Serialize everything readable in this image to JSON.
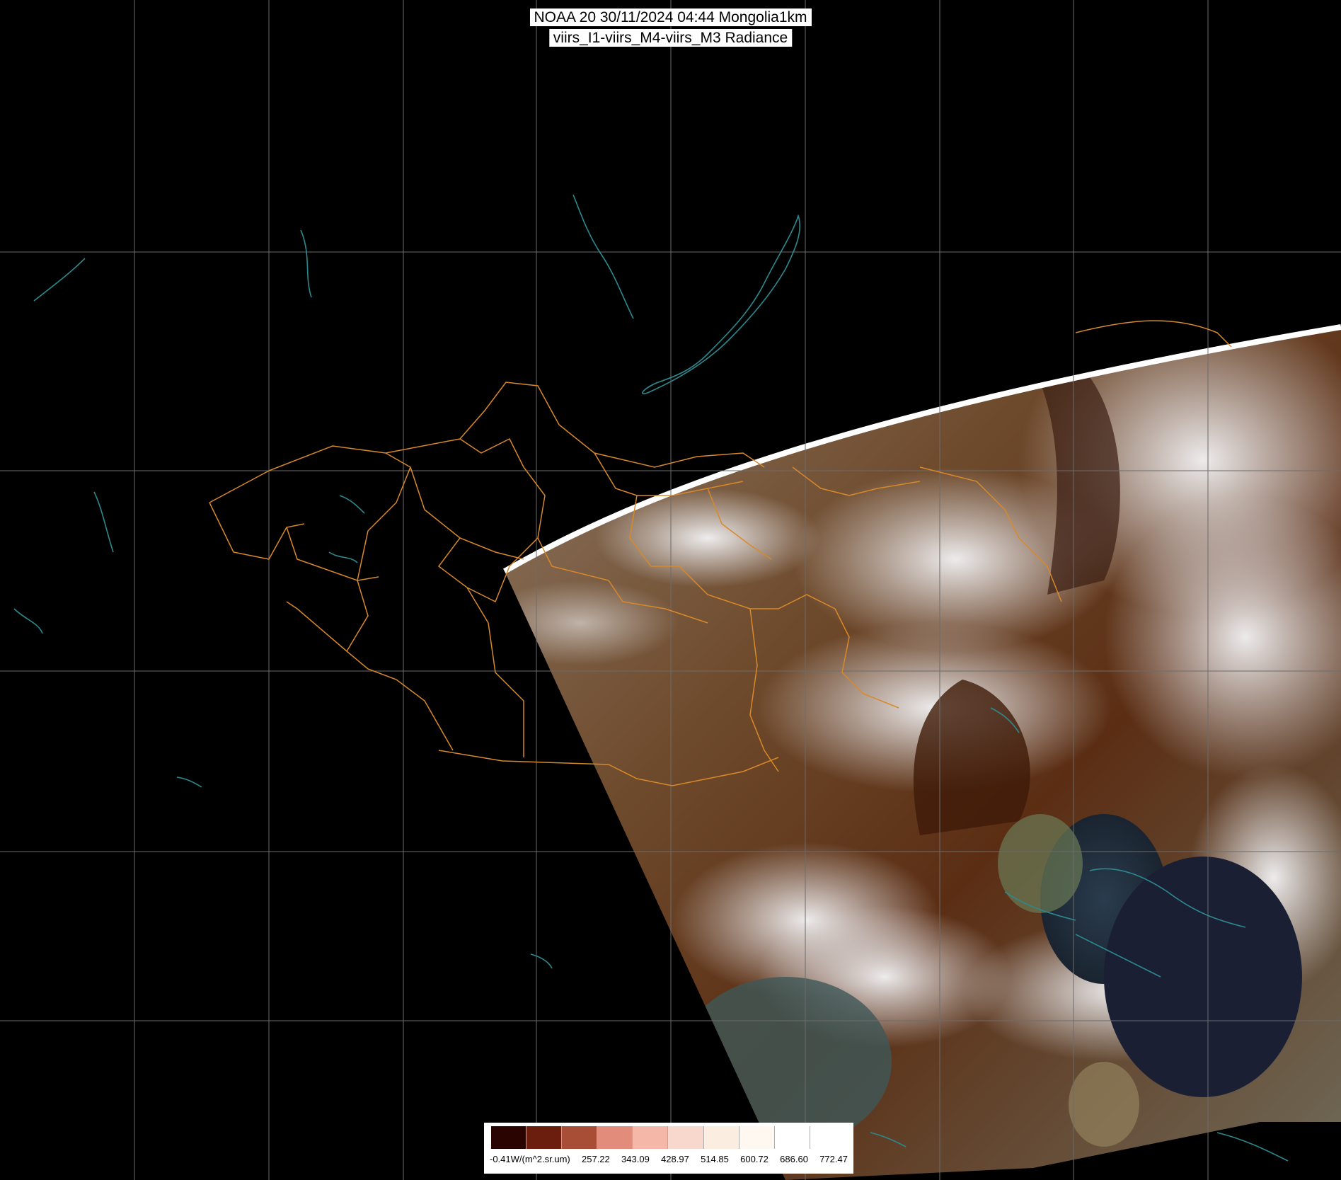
{
  "title": {
    "line1": "NOAA 20 30/11/2024 04:44 Mongolia1km",
    "line2": "viirs_I1-viirs_M4-viirs_M3 Radiance"
  },
  "legend": {
    "ticks": [
      "-0.41W/(m^2.sr.um)",
      "257.22",
      "343.09",
      "428.97",
      "514.85",
      "600.72",
      "686.60",
      "772.47"
    ],
    "colors": [
      "#2a0400",
      "#6b1d0e",
      "#a84e36",
      "#e28c7c",
      "#f5b8a8",
      "#f8d8cc",
      "#fbeee0",
      "#fef8f0",
      "#ffffff",
      "#ffffff"
    ]
  },
  "colors": {
    "background": "#000000",
    "grid": "#7a7a7a",
    "borders": "#d8892a",
    "water": "#2c8a8f"
  }
}
